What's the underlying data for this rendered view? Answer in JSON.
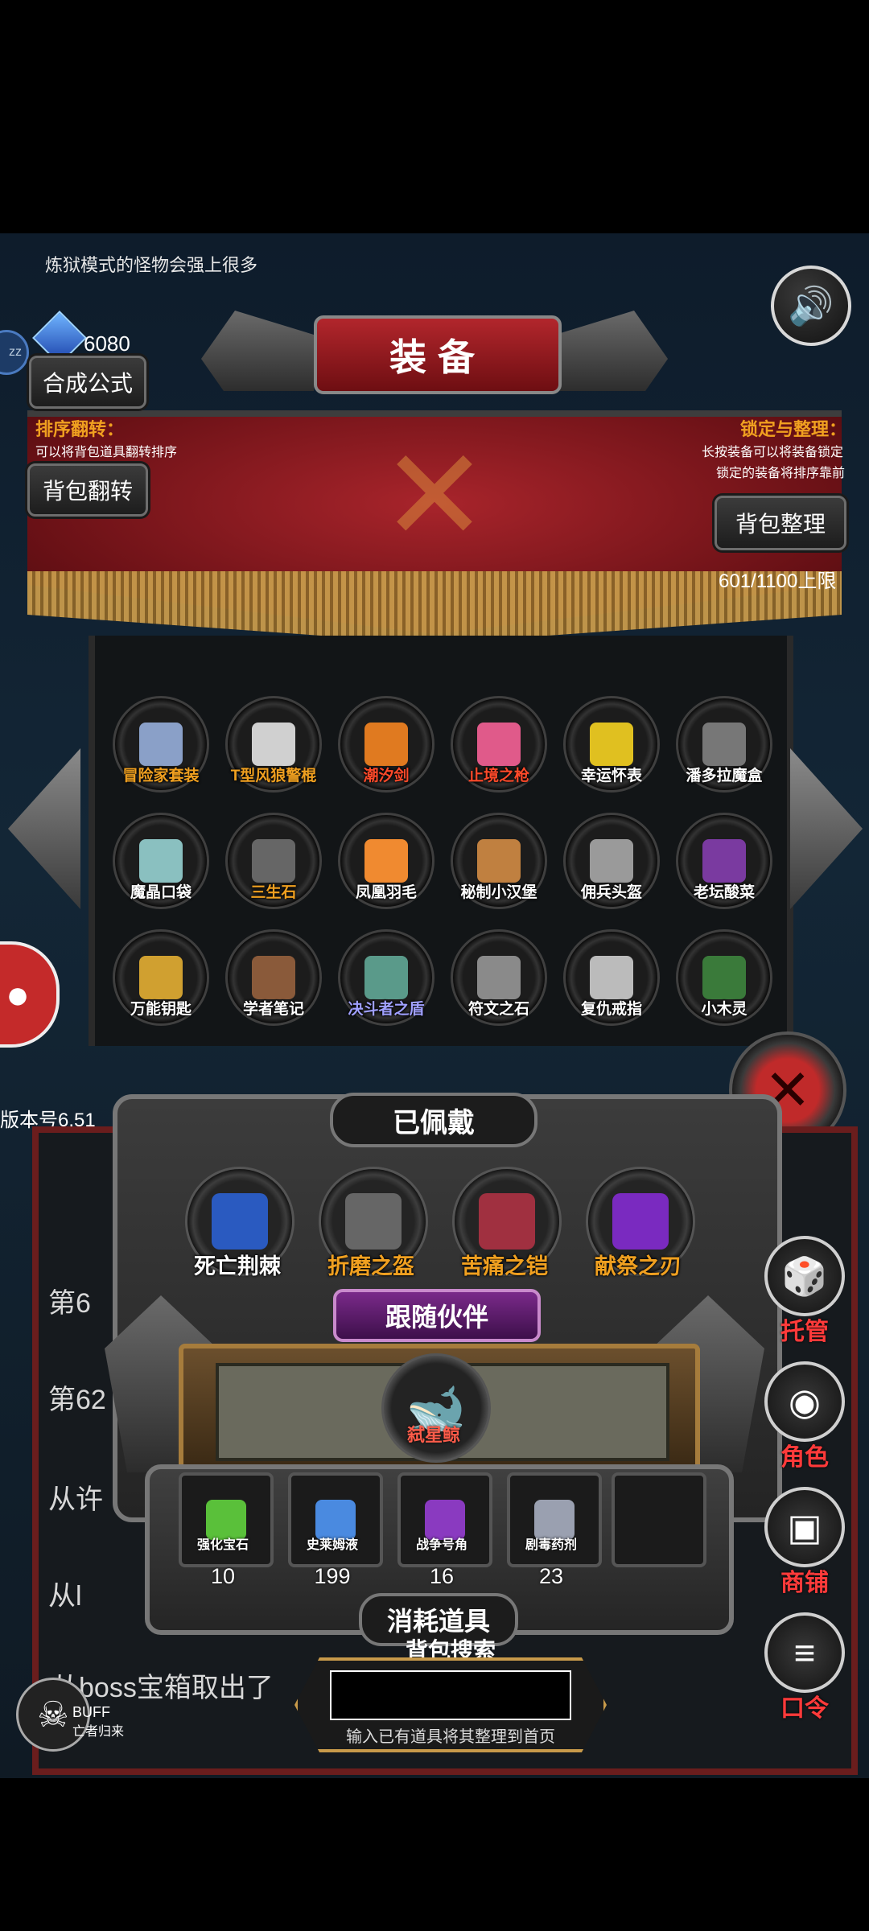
{
  "hint": "炼狱模式的怪物会强上很多",
  "currency": {
    "value": "6080"
  },
  "side_badge": "zz",
  "formula_btn": "合成公式",
  "title": "装备",
  "sort_flip": {
    "title": "排序翻转：",
    "note": "可以将背包道具翻转排序",
    "button": "背包翻转"
  },
  "lock_sort": {
    "title": "锁定与整理：",
    "note1": "长按装备可以将装备锁定",
    "note2": "锁定的装备将排序靠前",
    "button": "背包整理"
  },
  "capacity": "601/1100上限",
  "inventory": [
    {
      "label": "冒险家套装",
      "color": "#f0a020",
      "icon": "adventurer-outfit-icon",
      "glyph": "#8aa0c8"
    },
    {
      "label": "T型风狼警棍",
      "color": "#f0a020",
      "icon": "baton-icon",
      "glyph": "#d0d0d0"
    },
    {
      "label": "潮汐剑",
      "color": "#ff4a2a",
      "icon": "sword-icon",
      "glyph": "#e07a20"
    },
    {
      "label": "止境之枪",
      "color": "#ff4a2a",
      "icon": "spear-icon",
      "glyph": "#e05a8a"
    },
    {
      "label": "幸运怀表",
      "color": "#ffffff",
      "icon": "pocket-watch-icon",
      "glyph": "#e0c020"
    },
    {
      "label": "潘多拉魔盒",
      "color": "#ffffff",
      "icon": "pandora-box-icon",
      "glyph": "#777777"
    },
    {
      "label": "魔晶口袋",
      "color": "#ffffff",
      "icon": "pouch-icon",
      "glyph": "#8ac0c0"
    },
    {
      "label": "三生石",
      "color": "#f0a020",
      "icon": "stone-icon",
      "glyph": "#666666"
    },
    {
      "label": "凤凰羽毛",
      "color": "#ffffff",
      "icon": "feather-icon",
      "glyph": "#f08a30"
    },
    {
      "label": "秘制小汉堡",
      "color": "#ffffff",
      "icon": "burger-icon",
      "glyph": "#c08040"
    },
    {
      "label": "佣兵头盔",
      "color": "#ffffff",
      "icon": "helmet-icon",
      "glyph": "#9a9a9a"
    },
    {
      "label": "老坛酸菜",
      "color": "#ffffff",
      "icon": "pot-icon",
      "glyph": "#7a3aa0"
    },
    {
      "label": "万能钥匙",
      "color": "#ffffff",
      "icon": "key-icon",
      "glyph": "#d0a030"
    },
    {
      "label": "学者笔记",
      "color": "#ffffff",
      "icon": "notebook-icon",
      "glyph": "#8a5a3a"
    },
    {
      "label": "决斗者之盾",
      "color": "#a0a0ff",
      "icon": "shield-icon",
      "glyph": "#5a9a8a"
    },
    {
      "label": "符文之石",
      "color": "#ffffff",
      "icon": "rune-stone-icon",
      "glyph": "#8a8a8a"
    },
    {
      "label": "复仇戒指",
      "color": "#ffffff",
      "icon": "ring-icon",
      "glyph": "#bbbbbb"
    },
    {
      "label": "小木灵",
      "color": "#ffffff",
      "icon": "tree-spirit-icon",
      "glyph": "#3a7a3a"
    }
  ],
  "version": "版本号6.51",
  "log": {
    "l1": "第6",
    "l2": "第62",
    "l3": "从许",
    "l4": "从l",
    "boss": "从boss宝箱取出了"
  },
  "equipped_title": "已佩戴",
  "equipped": [
    {
      "label": "死亡荆棘",
      "color": "#ffffff",
      "icon": "thorn-icon",
      "glyph": "#2a5ac0"
    },
    {
      "label": "折磨之盔",
      "color": "#f0a020",
      "icon": "helmet-icon",
      "glyph": "#666666"
    },
    {
      "label": "苦痛之铠",
      "color": "#f0a020",
      "icon": "armor-icon",
      "glyph": "#a03040"
    },
    {
      "label": "献祭之刃",
      "color": "#f0a020",
      "icon": "blade-icon",
      "glyph": "#7a2ac0"
    }
  ],
  "companion": {
    "title": "跟随伙伴",
    "name": "弑星鲸",
    "color": "#ff5c4a",
    "icon": "whale-icon"
  },
  "consumables": [
    {
      "label": "强化宝石",
      "count": "10",
      "icon": "gem-icon",
      "glyph": "#5ac03a"
    },
    {
      "label": "史莱姆液",
      "count": "199",
      "icon": "potion-icon",
      "glyph": "#4a8ae0"
    },
    {
      "label": "战争号角",
      "count": "16",
      "icon": "horn-icon",
      "glyph": "#8a3ac0"
    },
    {
      "label": "剧毒药剂",
      "count": "23",
      "icon": "poison-icon",
      "glyph": "#9aa0b0"
    }
  ],
  "consumables_title": "消耗道具",
  "search": {
    "label": "背包搜索",
    "value": "",
    "hint": "输入已有道具将其整理到首页"
  },
  "side_actions": [
    {
      "label": "托管",
      "icon": "dice-icon",
      "glyph": "🎲"
    },
    {
      "label": "角色",
      "icon": "character-icon",
      "glyph": "◉"
    },
    {
      "label": "商铺",
      "icon": "shop-icon",
      "glyph": "▣"
    },
    {
      "label": "口令",
      "icon": "scroll-icon",
      "glyph": "≡"
    }
  ],
  "buff": {
    "title": "BUFF",
    "sub": "亡者归来"
  }
}
